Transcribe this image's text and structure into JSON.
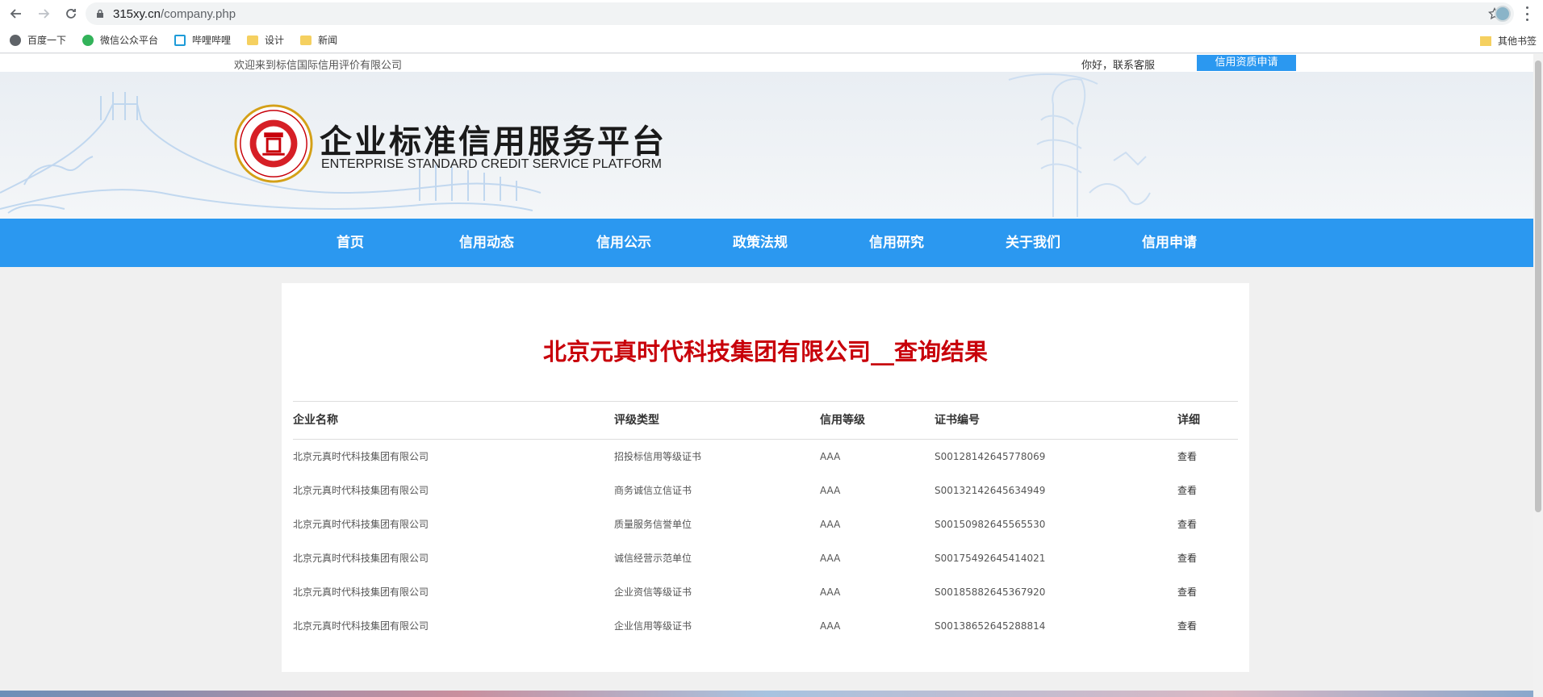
{
  "browser": {
    "url_host": "315xy.cn",
    "url_path": "/company.php",
    "bookmarks": [
      {
        "label": "百度一下",
        "icon": "baidu-icon"
      },
      {
        "label": "微信公众平台",
        "icon": "wechat-icon"
      },
      {
        "label": "哔哩哔哩",
        "icon": "bilibili-icon"
      },
      {
        "label": "设计",
        "icon": "folder-icon"
      },
      {
        "label": "新闻",
        "icon": "folder-icon"
      }
    ],
    "other_bookmarks": "其他书签"
  },
  "topbar": {
    "welcome": "欢迎来到标信国际信用评价有限公司",
    "hello": "你好，联系客服",
    "apply_button": "信用资质申请"
  },
  "header": {
    "title": "企业标准信用服务平台",
    "subtitle": "ENTERPRISE STANDARD CREDIT SERVICE PLATFORM"
  },
  "nav": {
    "items": [
      "首页",
      "信用动态",
      "信用公示",
      "政策法规",
      "信用研究",
      "关于我们",
      "信用申请"
    ]
  },
  "main": {
    "title": "北京元真时代科技集团有限公司__查询结果",
    "columns": [
      "企业名称",
      "评级类型",
      "信用等级",
      "证书编号",
      "详细"
    ],
    "rows": [
      {
        "name": "北京元真时代科技集团有限公司",
        "type": "招投标信用等级证书",
        "level": "AAA",
        "cert": "S00128142645778069",
        "detail": "查看"
      },
      {
        "name": "北京元真时代科技集团有限公司",
        "type": "商务诚信立信证书",
        "level": "AAA",
        "cert": "S00132142645634949",
        "detail": "查看"
      },
      {
        "name": "北京元真时代科技集团有限公司",
        "type": "质量服务信誉单位",
        "level": "AAA",
        "cert": "S00150982645565530",
        "detail": "查看"
      },
      {
        "name": "北京元真时代科技集团有限公司",
        "type": "诚信经营示范单位",
        "level": "AAA",
        "cert": "S00175492645414021",
        "detail": "查看"
      },
      {
        "name": "北京元真时代科技集团有限公司",
        "type": "企业资信等级证书",
        "level": "AAA",
        "cert": "S00185882645367920",
        "detail": "查看"
      },
      {
        "name": "北京元真时代科技集团有限公司",
        "type": "企业信用等级证书",
        "level": "AAA",
        "cert": "S00138652645288814",
        "detail": "查看"
      }
    ]
  },
  "colors": {
    "accent": "#2b98f0",
    "title_red": "#c8000a"
  }
}
